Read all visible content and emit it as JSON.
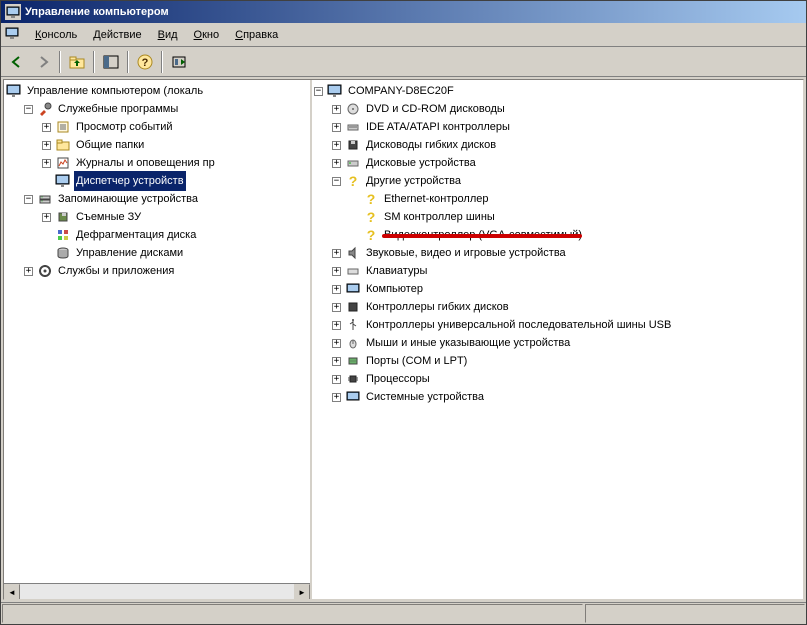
{
  "title": "Управление компьютером",
  "menu": {
    "console": "Консоль",
    "action": "Действие",
    "view": "Вид",
    "window": "Окно",
    "help": "Справка"
  },
  "left_tree": {
    "root": "Управление компьютером (локаль",
    "system_tools": "Служебные программы",
    "event_viewer": "Просмотр событий",
    "shared_folders": "Общие папки",
    "perf_logs": "Журналы и оповещения пр",
    "device_manager": "Диспетчер устройств",
    "storage": "Запоминающие устройства",
    "removable": "Съемные ЗУ",
    "defrag": "Дефрагментация диска",
    "disk_mgmt": "Управление дисками",
    "services_apps": "Службы и приложения"
  },
  "right_tree": {
    "root": "COMPANY-D8EC20F",
    "dvd": "DVD и CD-ROM дисководы",
    "ide": "IDE ATA/ATAPI контроллеры",
    "floppy_drives": "Дисководы гибких дисков",
    "disk_drives": "Дисковые устройства",
    "other_devices": "Другие устройства",
    "ethernet": "Ethernet-контроллер",
    "sm_bus": "SM контроллер шины",
    "vga": "Видеоконтроллер (VGA-совместимый)",
    "sound": "Звуковые, видео и игровые устройства",
    "keyboards": "Клавиатуры",
    "computer": "Компьютер",
    "floppy_ctrl": "Контроллеры гибких дисков",
    "usb_ctrl": "Контроллеры универсальной последовательной шины USB",
    "mice": "Мыши и иные указывающие устройства",
    "ports": "Порты (COM и LPT)",
    "processors": "Процессоры",
    "system_devices": "Системные устройства"
  }
}
